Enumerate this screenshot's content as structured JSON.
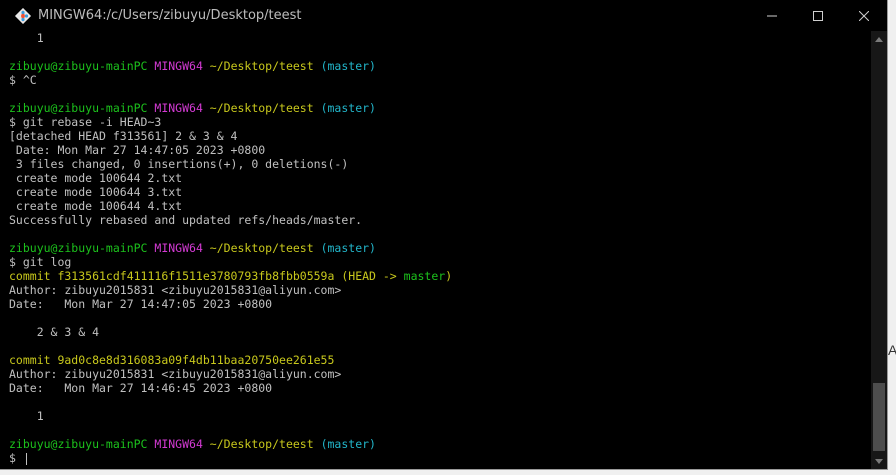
{
  "window": {
    "title": "MINGW64:/c/Users/zibuyu/Desktop/teest",
    "app_icon": "git-bash-icon",
    "controls": [
      "minimize-icon",
      "maximize-icon",
      "close-icon"
    ]
  },
  "colors": {
    "green": "#1cc11c",
    "magenta": "#d33ad3",
    "yellow": "#c8c81c",
    "cyan": "#22b5c9",
    "default": "#c0c0c0",
    "background": "#000000"
  },
  "terminal": {
    "lines": [
      [
        {
          "t": "    1",
          "c": "default"
        }
      ],
      [],
      [
        {
          "t": "zibuyu@zibuyu-mainPC ",
          "c": "green"
        },
        {
          "t": "MINGW64 ",
          "c": "magenta"
        },
        {
          "t": "~/Desktop/teest ",
          "c": "yellow"
        },
        {
          "t": "(master)",
          "c": "cyan"
        }
      ],
      [
        {
          "t": "$ ^C",
          "c": "default"
        }
      ],
      [],
      [
        {
          "t": "zibuyu@zibuyu-mainPC ",
          "c": "green"
        },
        {
          "t": "MINGW64 ",
          "c": "magenta"
        },
        {
          "t": "~/Desktop/teest ",
          "c": "yellow"
        },
        {
          "t": "(master)",
          "c": "cyan"
        }
      ],
      [
        {
          "t": "$ git rebase -i HEAD~3",
          "c": "default"
        }
      ],
      [
        {
          "t": "[detached HEAD f313561] 2 & 3 & 4",
          "c": "default"
        }
      ],
      [
        {
          "t": " Date: Mon Mar 27 14:47:05 2023 +0800",
          "c": "default"
        }
      ],
      [
        {
          "t": " 3 files changed, 0 insertions(+), 0 deletions(-)",
          "c": "default"
        }
      ],
      [
        {
          "t": " create mode 100644 2.txt",
          "c": "default"
        }
      ],
      [
        {
          "t": " create mode 100644 3.txt",
          "c": "default"
        }
      ],
      [
        {
          "t": " create mode 100644 4.txt",
          "c": "default"
        }
      ],
      [
        {
          "t": "Successfully rebased and updated refs/heads/master.",
          "c": "default"
        }
      ],
      [],
      [
        {
          "t": "zibuyu@zibuyu-mainPC ",
          "c": "green"
        },
        {
          "t": "MINGW64 ",
          "c": "magenta"
        },
        {
          "t": "~/Desktop/teest ",
          "c": "yellow"
        },
        {
          "t": "(master)",
          "c": "cyan"
        }
      ],
      [
        {
          "t": "$ git log",
          "c": "default"
        }
      ],
      [
        {
          "t": "commit f313561cdf411116f1511e3780793fb8fbb0559a ",
          "c": "yellow"
        },
        {
          "t": "(HEAD -> ",
          "c": "yellow"
        },
        {
          "t": "master",
          "c": "green"
        },
        {
          "t": ")",
          "c": "yellow"
        }
      ],
      [
        {
          "t": "Author: zibuyu2015831 <zibuyu2015831@aliyun.com>",
          "c": "default"
        }
      ],
      [
        {
          "t": "Date:   Mon Mar 27 14:47:05 2023 +0800",
          "c": "default"
        }
      ],
      [],
      [
        {
          "t": "    2 & 3 & 4",
          "c": "default"
        }
      ],
      [],
      [
        {
          "t": "commit 9ad0c8e8d316083a09f4db11baa20750ee261e55",
          "c": "yellow"
        }
      ],
      [
        {
          "t": "Author: zibuyu2015831 <zibuyu2015831@aliyun.com>",
          "c": "default"
        }
      ],
      [
        {
          "t": "Date:   Mon Mar 27 14:46:45 2023 +0800",
          "c": "default"
        }
      ],
      [],
      [
        {
          "t": "    1",
          "c": "default"
        }
      ],
      [],
      [
        {
          "t": "zibuyu@zibuyu-mainPC ",
          "c": "green"
        },
        {
          "t": "MINGW64 ",
          "c": "magenta"
        },
        {
          "t": "~/Desktop/teest ",
          "c": "yellow"
        },
        {
          "t": "(master)",
          "c": "cyan"
        }
      ],
      [
        {
          "t": "$ ",
          "c": "default"
        }
      ]
    ]
  },
  "edge_text": "A"
}
